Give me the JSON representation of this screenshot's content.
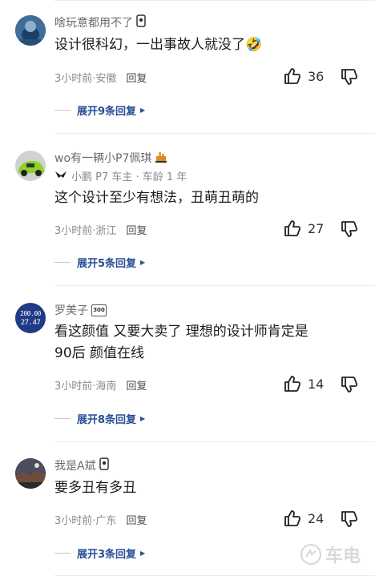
{
  "comments": [
    {
      "name": "啥玩意都用不了",
      "owner": "",
      "text": "设计很科幻，一出事故人就没了🤣",
      "time_loc": "3小时前·安徽",
      "reply": "回复",
      "likes": "36",
      "expand": "展开9条回复"
    },
    {
      "name": "wo有一辆小P7佩琪",
      "owner": "小鹏 P7 车主 · 车龄 1 年",
      "text": "这个设计至少有想法，丑萌丑萌的",
      "time_loc": "3小时前·浙江",
      "reply": "回复",
      "likes": "27",
      "expand": "展开5条回复"
    },
    {
      "name": "罗美子",
      "owner": "",
      "text_line1": "看这颜值 又要大卖了 理想的设计师肯定是",
      "text_line2": "90后 颜值在线",
      "time_loc": "3小时前·海南",
      "reply": "回复",
      "likes": "14",
      "expand": "展开8条回复",
      "avatar_top": "200.00",
      "avatar_bottom": "27.47"
    },
    {
      "name": "我是A斌",
      "owner": "",
      "text": "要多丑有多丑",
      "time_loc": "3小时前·广东",
      "reply": "回复",
      "likes": "24",
      "expand": "展开3条回复"
    }
  ],
  "badges": {
    "level": "300"
  },
  "watermark": "车电"
}
